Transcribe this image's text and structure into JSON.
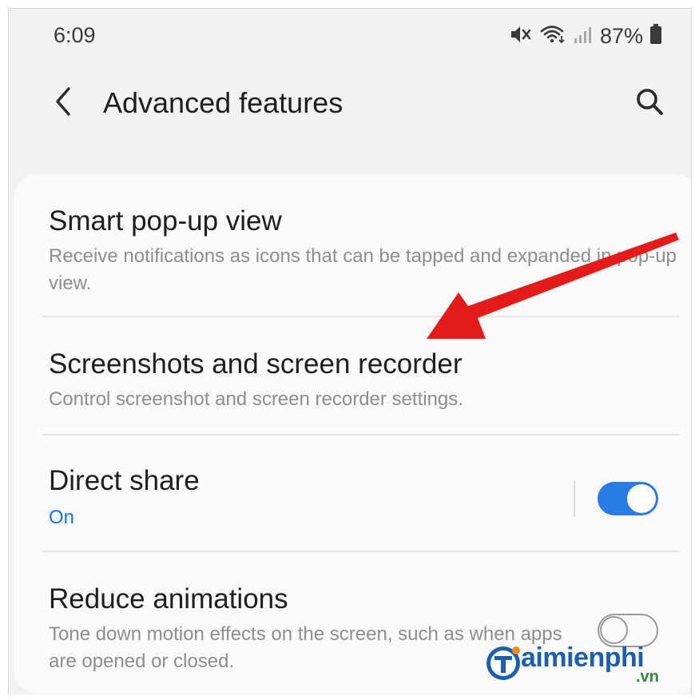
{
  "status_bar": {
    "time": "6:09",
    "battery": "87%",
    "icons": [
      "mute-icon",
      "wifi-icon",
      "signal-icon",
      "battery-icon"
    ]
  },
  "header": {
    "title": "Advanced features",
    "back_icon": "chevron-left-icon",
    "search_icon": "search-icon"
  },
  "settings": {
    "items": [
      {
        "title": "Smart pop-up view",
        "description": "Receive notifications as icons that can be tapped and expanded in pop-up view."
      },
      {
        "title": "Screenshots and screen recorder",
        "description": "Control screenshot and screen recorder settings."
      },
      {
        "title": "Direct share",
        "status": "On",
        "toggle_on": true
      },
      {
        "title": "Reduce animations",
        "description": "Tone down motion effects on the screen, such as when apps are opened or closed.",
        "toggle_on": false
      }
    ]
  },
  "annotation": {
    "arrow_color": "#e41b1b"
  },
  "watermark": {
    "brand_text": "aimienphi",
    "tld": ".vn"
  },
  "colors": {
    "accent": "#2a7be4",
    "status_text": "#1a73d9",
    "background": "#f2f2f2",
    "card": "#fafafa"
  }
}
